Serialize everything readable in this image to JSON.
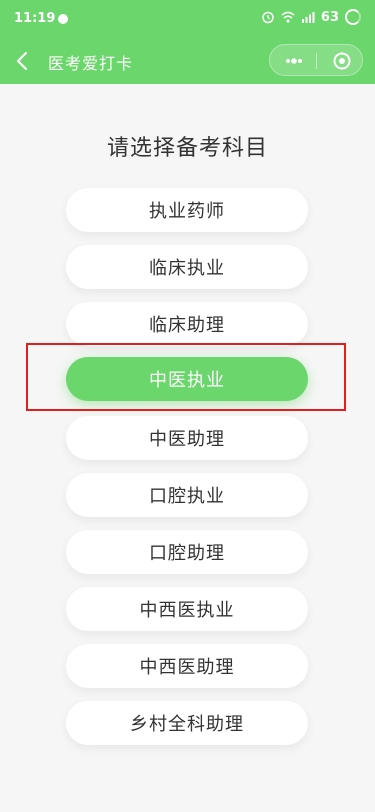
{
  "status_bar": {
    "time": "11:19",
    "battery": "63"
  },
  "nav": {
    "title": "医考爱打卡"
  },
  "heading": "请选择备考科目",
  "options": [
    {
      "label": "执业药师"
    },
    {
      "label": "临床执业"
    },
    {
      "label": "临床助理"
    },
    {
      "label": "中医执业",
      "selected": true
    },
    {
      "label": "中医助理"
    },
    {
      "label": "口腔执业"
    },
    {
      "label": "口腔助理"
    },
    {
      "label": "中西医执业"
    },
    {
      "label": "中西医助理"
    },
    {
      "label": "乡村全科助理"
    }
  ],
  "colors": {
    "accent": "#6bd66b",
    "highlight": "#e02020"
  }
}
